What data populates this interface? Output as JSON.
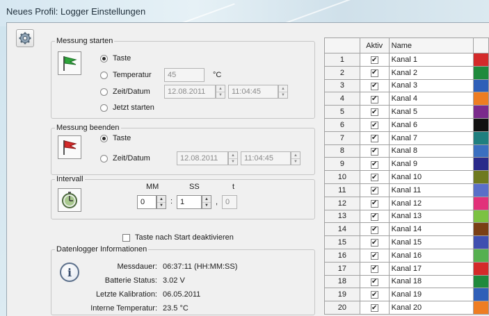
{
  "window": {
    "title": "Neues Profil: Logger Einstellungen"
  },
  "start": {
    "legend": "Messung starten",
    "options": {
      "taste": "Taste",
      "temperatur": "Temperatur",
      "zeit": "Zeit/Datum",
      "jetzt": "Jetzt starten"
    },
    "selected": "Taste",
    "temp_value": "45",
    "temp_unit": "°C",
    "date": "12.08.2011",
    "time": "11:04:45"
  },
  "stop": {
    "legend": "Messung beenden",
    "options": {
      "taste": "Taste",
      "zeit": "Zeit/Datum"
    },
    "selected": "Taste",
    "date": "12.08.2011",
    "time": "11:04:45"
  },
  "interval": {
    "legend": "Intervall",
    "labels": {
      "mm": "MM",
      "ss": "SS",
      "t": "t"
    },
    "mm": "0",
    "ss": "1",
    "t": "0",
    "sep_colon": ":",
    "sep_comma": ","
  },
  "disable_key": {
    "label": "Taste nach Start deaktivieren",
    "checked": false
  },
  "info": {
    "legend": "Datenlogger Informationen",
    "rows": [
      {
        "key": "Messdauer:",
        "value": "06:37:11 (HH:MM:SS)"
      },
      {
        "key": "Batterie Status:",
        "value": "3.02 V"
      },
      {
        "key": "Letzte Kalibration:",
        "value": "06.05.2011"
      },
      {
        "key": "Interne Temperatur:",
        "value": "23.5 °C"
      }
    ]
  },
  "channels": {
    "headers": {
      "num": "",
      "aktiv": "Aktiv",
      "name": "Name"
    },
    "check_glyph": "✔",
    "rows": [
      {
        "num": "1",
        "name": "Kanal 1",
        "color": "#d42a2a"
      },
      {
        "num": "2",
        "name": "Kanal 2",
        "color": "#1f8a3c"
      },
      {
        "num": "3",
        "name": "Kanal 3",
        "color": "#2f5fb8"
      },
      {
        "num": "4",
        "name": "Kanal 4",
        "color": "#ee7d22"
      },
      {
        "num": "5",
        "name": "Kanal 5",
        "color": "#7b2a8c"
      },
      {
        "num": "6",
        "name": "Kanal 6",
        "color": "#111111"
      },
      {
        "num": "7",
        "name": "Kanal 7",
        "color": "#1f7f7f"
      },
      {
        "num": "8",
        "name": "Kanal 8",
        "color": "#3a6fc0"
      },
      {
        "num": "9",
        "name": "Kanal 9",
        "color": "#2a2a8a"
      },
      {
        "num": "10",
        "name": "Kanal 10",
        "color": "#6f7a1f"
      },
      {
        "num": "11",
        "name": "Kanal 11",
        "color": "#5a6fc8"
      },
      {
        "num": "12",
        "name": "Kanal 12",
        "color": "#e2317a"
      },
      {
        "num": "13",
        "name": "Kanal 13",
        "color": "#7cc242"
      },
      {
        "num": "14",
        "name": "Kanal 14",
        "color": "#7a3f14"
      },
      {
        "num": "15",
        "name": "Kanal 15",
        "color": "#3f4fb0"
      },
      {
        "num": "16",
        "name": "Kanal 16",
        "color": "#56b050"
      },
      {
        "num": "17",
        "name": "Kanal 17",
        "color": "#d42a2a"
      },
      {
        "num": "18",
        "name": "Kanal 18",
        "color": "#1f8a3c"
      },
      {
        "num": "19",
        "name": "Kanal 19",
        "color": "#2f5fb8"
      },
      {
        "num": "20",
        "name": "Kanal 20",
        "color": "#ee7d22"
      }
    ]
  }
}
